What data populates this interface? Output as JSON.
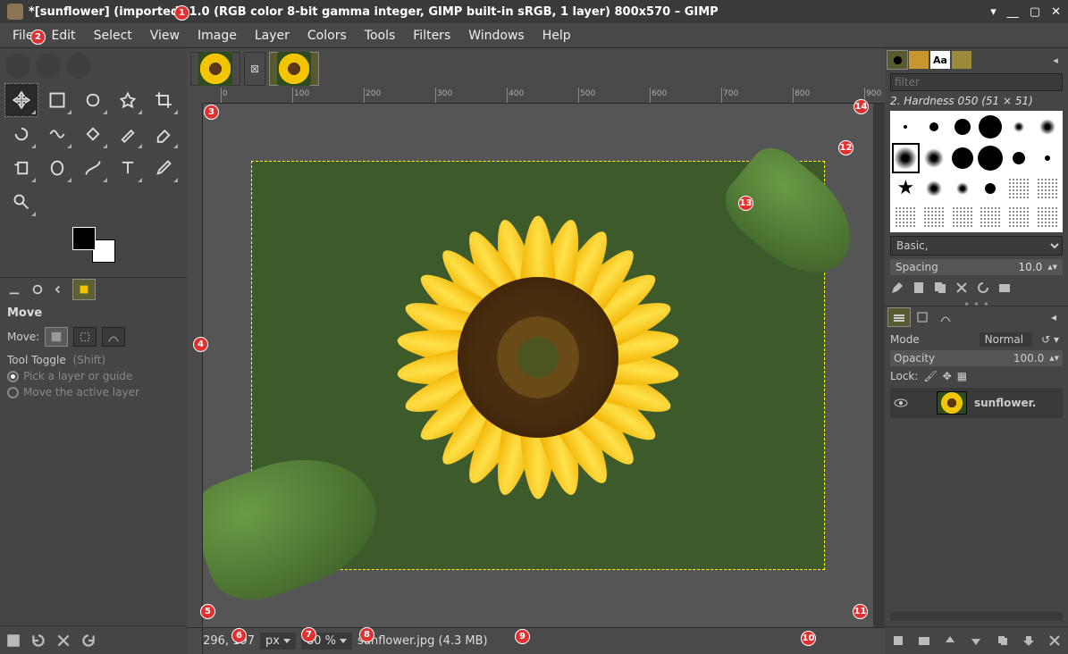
{
  "titlebar": {
    "text": "*[sunflower] (imported)-1.0 (RGB color 8-bit gamma integer, GIMP built-in sRGB, 1 layer) 800x570 – GIMP"
  },
  "menu": {
    "items": [
      "File",
      "Edit",
      "Select",
      "View",
      "Image",
      "Layer",
      "Colors",
      "Tools",
      "Filters",
      "Windows",
      "Help"
    ]
  },
  "toolbox": {
    "tools": [
      "move",
      "rect-select",
      "free-select",
      "fuzzy-select",
      "crop",
      "rotate",
      "warp",
      "bucket",
      "paintbrush",
      "eraser",
      "clone",
      "smudge",
      "path",
      "text",
      "color-picker",
      "zoom"
    ]
  },
  "tool_options": {
    "title": "Move",
    "move_label": "Move:",
    "toggle_label": "Tool Toggle",
    "toggle_hint": "(Shift)",
    "opt1": "Pick a layer or guide",
    "opt2": "Move the active layer"
  },
  "canvas": {
    "ruler_marks": [
      0,
      100,
      200,
      300,
      400,
      500,
      600,
      700,
      800,
      900
    ],
    "coords": "296, 197",
    "unit": "px",
    "zoom": "80 %",
    "filename": "sunflower.jpg (4.3  MB)"
  },
  "brush": {
    "filter_placeholder": "filter",
    "name": "2. Hardness 050 (51 × 51)",
    "preset": "Basic,",
    "spacing_label": "Spacing",
    "spacing_value": "10.0"
  },
  "layers": {
    "mode_label": "Mode",
    "mode_value": "Normal",
    "opacity_label": "Opacity",
    "opacity_value": "100.0",
    "lock_label": "Lock:",
    "layer_name": "sunflower."
  }
}
